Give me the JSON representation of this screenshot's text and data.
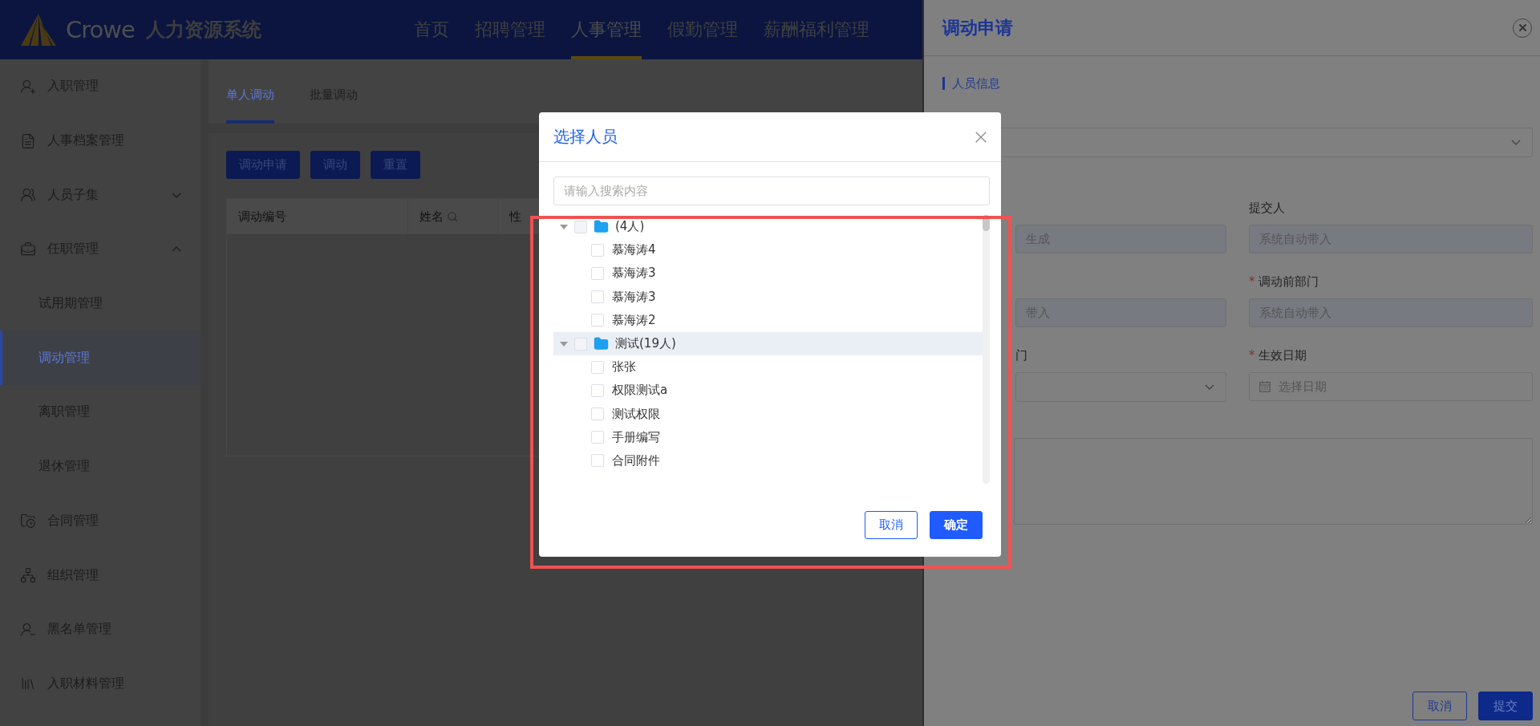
{
  "header": {
    "logo_text": "Crowe",
    "system_name": "人力资源系统",
    "nav": [
      {
        "label": "首页",
        "selected": false
      },
      {
        "label": "招聘管理",
        "selected": false
      },
      {
        "label": "人事管理",
        "selected": true
      },
      {
        "label": "假勤管理",
        "selected": false
      },
      {
        "label": "薪酬福利管理",
        "selected": false
      }
    ]
  },
  "sidebar": {
    "items": [
      {
        "label": "入职管理",
        "selected": false
      },
      {
        "label": "人事档案管理",
        "selected": false
      },
      {
        "label": "人员子集",
        "selected": false,
        "expanded": false
      },
      {
        "label": "任职管理",
        "selected": false,
        "expanded": true,
        "children": [
          {
            "label": "试用期管理",
            "selected": false
          },
          {
            "label": "调动管理",
            "selected": true
          },
          {
            "label": "离职管理",
            "selected": false
          },
          {
            "label": "退休管理",
            "selected": false
          }
        ]
      },
      {
        "label": "合同管理",
        "selected": false
      },
      {
        "label": "组织管理",
        "selected": false
      },
      {
        "label": "黑名单管理",
        "selected": false
      },
      {
        "label": "入职材料管理",
        "selected": false
      }
    ]
  },
  "content": {
    "tabs": [
      {
        "label": "单人调动",
        "selected": true
      },
      {
        "label": "批量调动",
        "selected": false
      }
    ],
    "buttons": [
      "调动申请",
      "调动",
      "重置"
    ],
    "table": {
      "columns": [
        {
          "label": "调动编号",
          "searchable": false
        },
        {
          "label": "姓名",
          "searchable": true
        },
        {
          "label": "性",
          "searchable": false
        }
      ]
    }
  },
  "drawer": {
    "title": "调动申请",
    "section_title": "人员信息",
    "rows": [
      {
        "left": {
          "kind": "input",
          "placeholder": "生成"
        },
        "right": {
          "kind": "input",
          "label": "提交人",
          "placeholder": "系统自动带入"
        }
      },
      {
        "left": {
          "kind": "input",
          "placeholder": "带入"
        },
        "right": {
          "kind": "input",
          "label": "调动前部门",
          "required_mark": "*",
          "placeholder": "系统自动带入"
        }
      },
      {
        "left": {
          "kind": "select",
          "label": "门"
        },
        "right": {
          "kind": "date",
          "label": "生效日期",
          "required_mark": "*",
          "placeholder": "选择日期"
        }
      }
    ],
    "buttons": [
      {
        "label": "取消",
        "primary": false
      },
      {
        "label": "提交",
        "primary": true
      }
    ]
  },
  "modal": {
    "title": "选择人员",
    "search": {
      "placeholder": "请输入搜索内容"
    },
    "tree": [
      {
        "label": "(4人)",
        "expanded": true,
        "checked": false,
        "highlighted": false,
        "children": [
          {
            "label": "慕海涛4",
            "checked": false
          },
          {
            "label": "慕海涛3",
            "checked": false
          },
          {
            "label": "慕海涛3",
            "checked": false
          },
          {
            "label": "慕海涛2",
            "checked": false
          }
        ]
      },
      {
        "label": "测试(19人)",
        "expanded": true,
        "checked": false,
        "highlighted": true,
        "children": [
          {
            "label": "张张",
            "checked": false
          },
          {
            "label": "权限测试a",
            "checked": false
          },
          {
            "label": "测试权限",
            "checked": false
          },
          {
            "label": "手册编写",
            "checked": false
          },
          {
            "label": "合同附件",
            "checked": false
          }
        ]
      }
    ],
    "buttons": [
      {
        "label": "取消",
        "primary": false
      },
      {
        "label": "确定",
        "primary": true
      }
    ]
  }
}
